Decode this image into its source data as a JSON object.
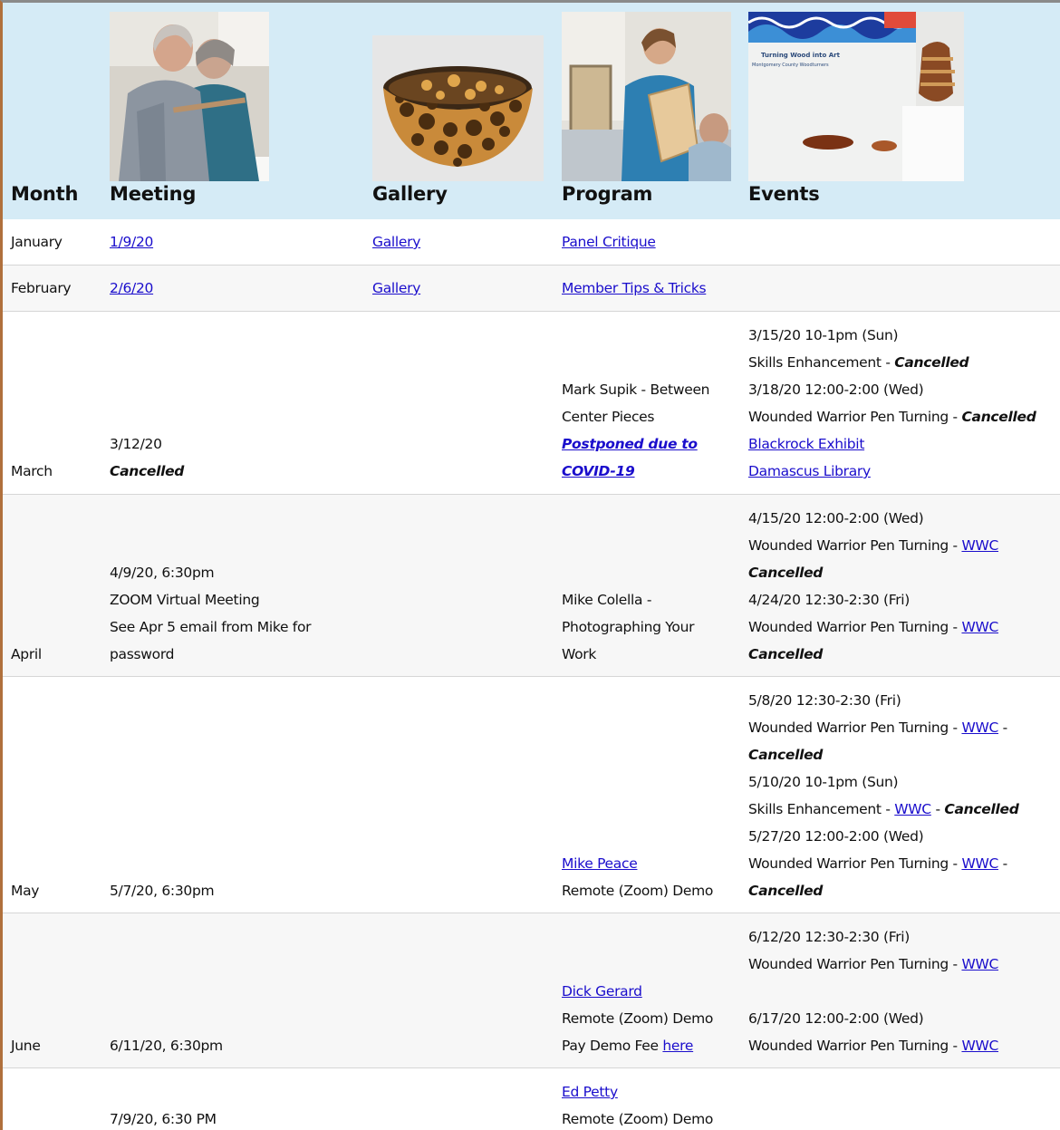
{
  "header": {
    "month": "Month",
    "meeting": "Meeting",
    "gallery": "Gallery",
    "program": "Program",
    "events": "Events"
  },
  "photos": {
    "meeting_photo": "two people at a woodturners meeting",
    "gallery_photo": "turned wooden bowl",
    "program_photo": "presenter holding a turned piece",
    "events_photo": "Turning Wood into Art exhibit"
  },
  "exhibit_banner": {
    "title": "Turning Wood into Art",
    "subtitle": "Montgomery County Woodturners"
  },
  "rows": {
    "jan": {
      "month": "January",
      "meeting": "1/9/20",
      "gallery": "Gallery",
      "program": "Panel Critique"
    },
    "feb": {
      "month": "February",
      "meeting": "2/6/20",
      "gallery": "Gallery",
      "program": "Member Tips & Tricks"
    },
    "mar": {
      "month": "March",
      "meeting_date": "3/12/20",
      "meeting_status": "Cancelled",
      "program_l1": "Mark Supik - Between",
      "program_l2": "Center Pieces",
      "program_link_l1": "Postponed due to",
      "program_link_l2": "COVID-19",
      "evt1_date": "3/15/20 10-1pm (Sun)",
      "evt1_name": "Skills Enhancement - ",
      "evt1_status": "Cancelled",
      "evt2_date": "3/18/20 12:00-2:00 (Wed)",
      "evt2_name": "Wounded Warrior Pen Turning - ",
      "evt2_status": "Cancelled",
      "evt3_link": "Blackrock Exhibit",
      "evt4_link": "Damascus Library"
    },
    "apr": {
      "month": "April",
      "meeting_l1": "4/9/20, 6:30pm",
      "meeting_l2": "ZOOM Virtual Meeting",
      "meeting_l3": "See Apr 5 email from Mike for",
      "meeting_l4": "password",
      "program_l1": "Mike Colella -",
      "program_l2": "Photographing Your",
      "program_l3": "Work",
      "evt1_date": "4/15/20 12:00-2:00 (Wed)",
      "evt1_name": "Wounded Warrior Pen Turning - ",
      "evt1_link": "WWC",
      "evt1_status": "Cancelled",
      "evt2_date": "4/24/20 12:30-2:30 (Fri)",
      "evt2_name": "Wounded Warrior Pen Turning - ",
      "evt2_link": "WWC",
      "evt2_status": "Cancelled"
    },
    "may": {
      "month": "May",
      "meeting": "5/7/20, 6:30pm",
      "program_link": "Mike Peace",
      "program_l2": "Remote (Zoom) Demo",
      "evt1_date": "5/8/20 12:30-2:30 (Fri)",
      "evt1_name": "Wounded Warrior Pen Turning - ",
      "evt1_link": "WWC",
      "evt1_sep": " -",
      "evt1_status": "Cancelled",
      "evt2_date": "5/10/20 10-1pm (Sun)",
      "evt2_name": "Skills Enhancement - ",
      "evt2_link": "WWC",
      "evt2_sep": " - ",
      "evt2_status": "Cancelled",
      "evt3_date": "5/27/20 12:00-2:00 (Wed)",
      "evt3_name": "Wounded Warrior Pen Turning - ",
      "evt3_link": "WWC",
      "evt3_sep": " -",
      "evt3_status": "Cancelled"
    },
    "jun": {
      "month": "June",
      "meeting": "6/11/20, 6:30pm",
      "program_link": "Dick Gerard",
      "program_l2": "Remote (Zoom) Demo",
      "program_l3": "Pay Demo Fee ",
      "program_l3_link": "here",
      "evt1_date": "6/12/20 12:30-2:30 (Fri)",
      "evt1_name": "Wounded Warrior Pen Turning - ",
      "evt1_link": "WWC",
      "evt2_date": "6/17/20 12:00-2:00 (Wed)",
      "evt2_name": "Wounded Warrior Pen Turning - ",
      "evt2_link": "WWC"
    },
    "jul": {
      "meeting": "7/9/20, 6:30 PM",
      "program_link": "Ed Petty",
      "program_l2": "Remote (Zoom) Demo"
    }
  }
}
